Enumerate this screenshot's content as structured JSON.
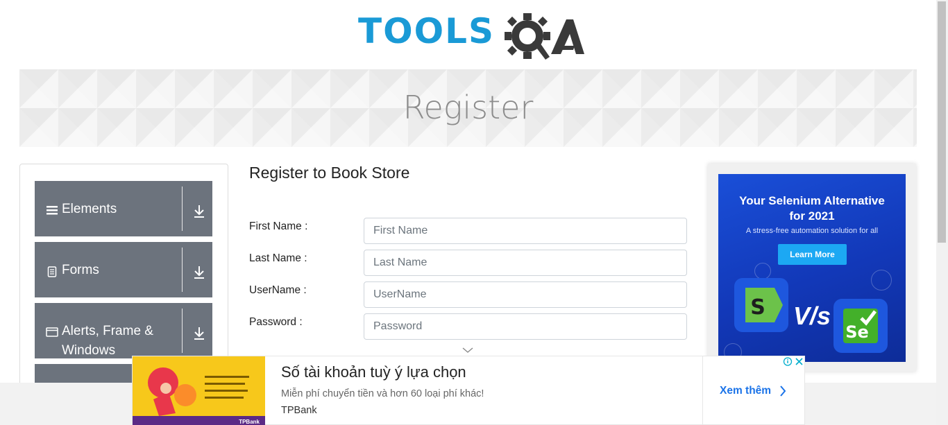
{
  "logo": {
    "tools": "TOOLS",
    "qa": "QA"
  },
  "banner": {
    "title": "Register"
  },
  "sidebar": {
    "groups": [
      {
        "label": "Elements",
        "icon": "hamburger-icon"
      },
      {
        "label": "Forms",
        "icon": "document-icon"
      },
      {
        "label": "Alerts, Frame & Windows",
        "icon": "window-icon"
      }
    ]
  },
  "form": {
    "title": "Register to Book Store",
    "fields": [
      {
        "label": "First Name :",
        "placeholder": "First Name"
      },
      {
        "label": "Last Name :",
        "placeholder": "Last Name"
      },
      {
        "label": "UserName :",
        "placeholder": "UserName"
      },
      {
        "label": "Password :",
        "placeholder": "Password"
      }
    ]
  },
  "right_ad": {
    "headline_1": "Your Selenium Alternative",
    "headline_2": "for 2021",
    "subline": "A stress-free automation solution for all",
    "button": "Learn More",
    "vs": "V/s",
    "colors": {
      "background": "#1a4fd8",
      "button": "#1ca8f3",
      "katalon_green": "#6cc24a",
      "selenium_green": "#43b02a"
    }
  },
  "bottom_ad": {
    "title": "Số tài khoản tuỳ ý lựa chọn",
    "description": "Miễn phí chuyển tiền và hơn 60 loại phí khác!",
    "brand": "TPBank",
    "cta": "Xem thêm",
    "image_text": "TPBank"
  },
  "colors": {
    "logo_blue": "#1a9ad6",
    "logo_dark": "#3a3a3a",
    "sidebar_bg": "#6c737d",
    "banner_text": "#8c8c8c"
  }
}
